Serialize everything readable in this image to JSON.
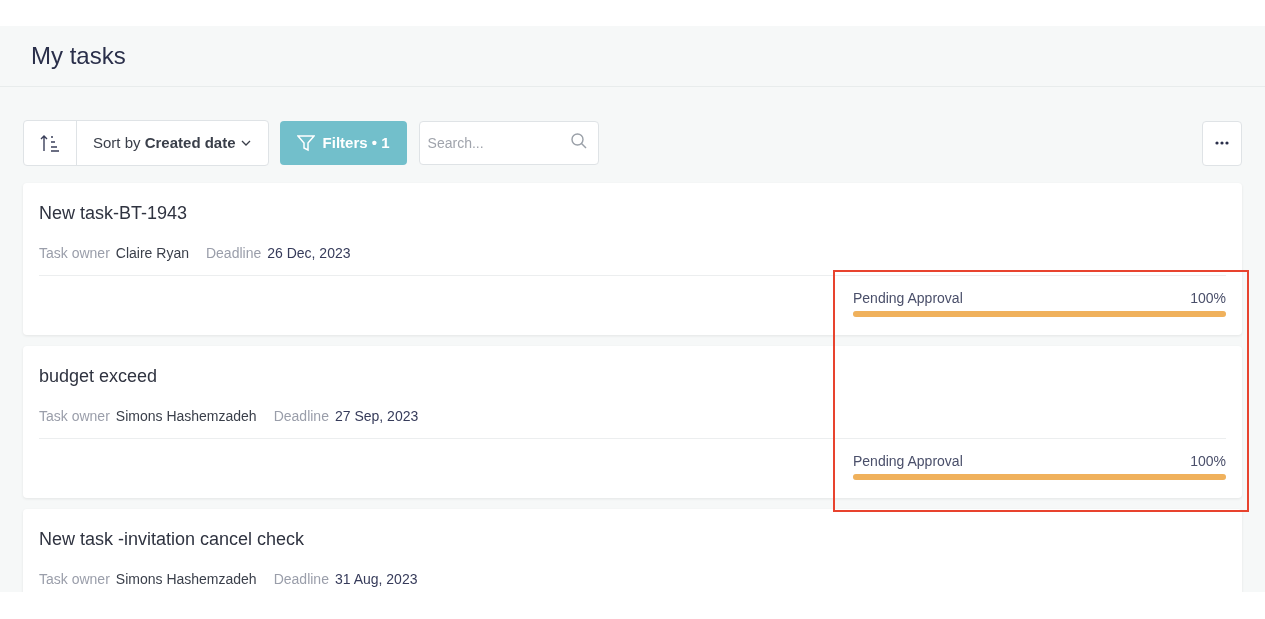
{
  "page": {
    "title": "My tasks"
  },
  "toolbar": {
    "sort_label": "Sort by **Created date**",
    "filters_label": "Filters • 1",
    "search": {
      "placeholder": "Search..."
    }
  },
  "tasks": [
    {
      "title": "New task-BT-1943",
      "owner_label": "Task owner",
      "owner": "Claire Ryan",
      "deadline_label": "Deadline",
      "deadline": "26 Dec, 2023",
      "status": "Pending Approval",
      "percent": "100%",
      "level": 1
    },
    {
      "title": "budget exceed",
      "owner_label": "Task owner",
      "owner": "Simons Hashemzadeh",
      "deadline_label": "Deadline",
      "deadline": "27 Sep, 2023",
      "status": "Pending Approval",
      "percent": "100%",
      "level": 1
    },
    {
      "title": "New task -invitation cancel check",
      "owner_label": "Task owner",
      "owner": "Simons Hashemzadeh",
      "deadline_label": "Deadline",
      "deadline": "31 Aug, 2023"
    }
  ]
}
